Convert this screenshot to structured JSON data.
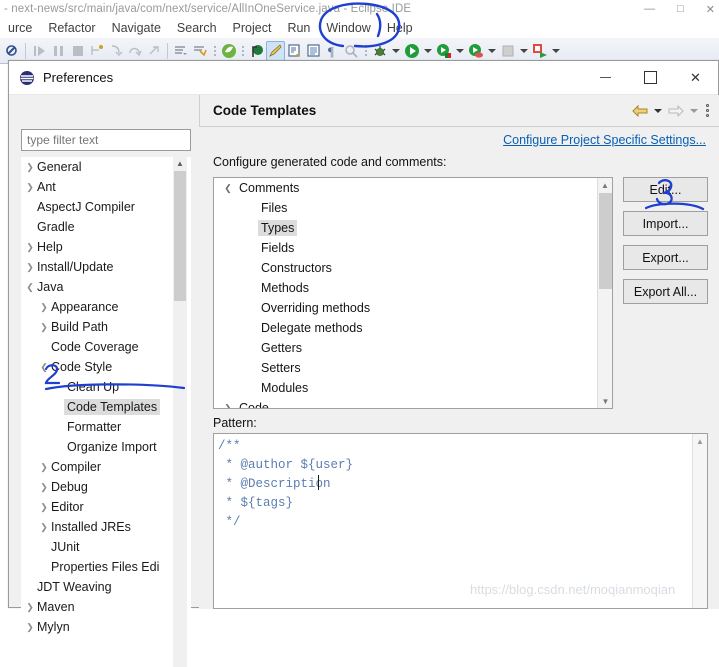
{
  "ide": {
    "title": "- next-news/src/main/java/com/next/service/AllInOneService.java - Eclipse IDE",
    "window_buttons": {
      "minimize": "—",
      "maximize": "□",
      "close": "✕"
    },
    "menu_items": [
      {
        "label": "urce",
        "name": "menu-source"
      },
      {
        "label": "Refactor",
        "name": "menu-refactor"
      },
      {
        "label": "Navigate",
        "name": "menu-navigate"
      },
      {
        "label": "Search",
        "name": "menu-search"
      },
      {
        "label": "Project",
        "name": "menu-project"
      },
      {
        "label": "Run",
        "name": "menu-run"
      },
      {
        "label": "Window",
        "name": "menu-window"
      },
      {
        "label": "Help",
        "name": "menu-help"
      }
    ],
    "toolbar_icons": [
      "skip-all-breakpoints-icon",
      "resume-icon",
      "suspend-icon",
      "terminate-icon",
      "step-into-selection-icon",
      "step-into-icon",
      "step-over-icon",
      "step-return-icon",
      "open-task-icon",
      "synchronize-icon",
      "spring-boot-icon",
      "open-type-icon",
      "java-editor-icon",
      "new-java-class-icon",
      "open-console-icon",
      "pilcrow-icon",
      "search-package-icon",
      "debug-icon",
      "run-icon",
      "run-coverage-icon",
      "profile-icon",
      "stop-icon",
      "external-tools-icon"
    ]
  },
  "prefs": {
    "title": "Preferences",
    "icon": "eclipse-sphere-icon",
    "window_buttons": {
      "minimize": "minimize-icon",
      "maximize": "maximize-icon",
      "close": "✕"
    },
    "filter": {
      "placeholder": "type filter text",
      "value": ""
    },
    "tree": [
      {
        "label": "General",
        "indent": 0,
        "expander": "collapsed",
        "selected": false
      },
      {
        "label": "Ant",
        "indent": 0,
        "expander": "collapsed",
        "selected": false
      },
      {
        "label": "AspectJ Compiler",
        "indent": 0,
        "expander": "none",
        "selected": false
      },
      {
        "label": "Gradle",
        "indent": 0,
        "expander": "none",
        "selected": false
      },
      {
        "label": "Help",
        "indent": 0,
        "expander": "collapsed",
        "selected": false
      },
      {
        "label": "Install/Update",
        "indent": 0,
        "expander": "collapsed",
        "selected": false
      },
      {
        "label": "Java",
        "indent": 0,
        "expander": "expanded",
        "selected": false
      },
      {
        "label": "Appearance",
        "indent": 1,
        "expander": "collapsed",
        "selected": false
      },
      {
        "label": "Build Path",
        "indent": 1,
        "expander": "collapsed",
        "selected": false
      },
      {
        "label": "Code Coverage",
        "indent": 1,
        "expander": "none",
        "selected": false
      },
      {
        "label": "Code Style",
        "indent": 1,
        "expander": "expanded",
        "selected": false
      },
      {
        "label": "Clean Up",
        "indent": 2,
        "expander": "none",
        "selected": false
      },
      {
        "label": "Code Templates",
        "indent": 2,
        "expander": "none",
        "selected": true
      },
      {
        "label": "Formatter",
        "indent": 2,
        "expander": "none",
        "selected": false
      },
      {
        "label": "Organize Import",
        "indent": 2,
        "expander": "none",
        "selected": false
      },
      {
        "label": "Compiler",
        "indent": 1,
        "expander": "collapsed",
        "selected": false
      },
      {
        "label": "Debug",
        "indent": 1,
        "expander": "collapsed",
        "selected": false
      },
      {
        "label": "Editor",
        "indent": 1,
        "expander": "collapsed",
        "selected": false
      },
      {
        "label": "Installed JREs",
        "indent": 1,
        "expander": "collapsed",
        "selected": false
      },
      {
        "label": "JUnit",
        "indent": 1,
        "expander": "none",
        "selected": false
      },
      {
        "label": "Properties Files Edi",
        "indent": 1,
        "expander": "none",
        "selected": false
      },
      {
        "label": "JDT Weaving",
        "indent": 0,
        "expander": "none",
        "selected": false
      },
      {
        "label": "Maven",
        "indent": 0,
        "expander": "collapsed",
        "selected": false
      },
      {
        "label": "Mylyn",
        "indent": 0,
        "expander": "collapsed",
        "selected": false
      }
    ],
    "page": {
      "title": "Code Templates",
      "nav": {
        "back": "back-arrow-icon",
        "forward": "forward-arrow-icon",
        "menu": "page-menu-icon"
      },
      "configure_link": "Configure Project Specific Settings...",
      "section_label": "Configure generated code and comments:",
      "templates_tree": [
        {
          "label": "Comments",
          "indent": 0,
          "expander": "expanded",
          "selected": false
        },
        {
          "label": "Files",
          "indent": 1,
          "expander": "none",
          "selected": false
        },
        {
          "label": "Types",
          "indent": 1,
          "expander": "none",
          "selected": true
        },
        {
          "label": "Fields",
          "indent": 1,
          "expander": "none",
          "selected": false
        },
        {
          "label": "Constructors",
          "indent": 1,
          "expander": "none",
          "selected": false
        },
        {
          "label": "Methods",
          "indent": 1,
          "expander": "none",
          "selected": false
        },
        {
          "label": "Overriding methods",
          "indent": 1,
          "expander": "none",
          "selected": false
        },
        {
          "label": "Delegate methods",
          "indent": 1,
          "expander": "none",
          "selected": false
        },
        {
          "label": "Getters",
          "indent": 1,
          "expander": "none",
          "selected": false
        },
        {
          "label": "Setters",
          "indent": 1,
          "expander": "none",
          "selected": false
        },
        {
          "label": "Modules",
          "indent": 1,
          "expander": "none",
          "selected": false
        },
        {
          "label": "Code",
          "indent": 0,
          "expander": "collapsed",
          "selected": false
        }
      ],
      "buttons": [
        {
          "label": "Edit...",
          "name": "edit-button"
        },
        {
          "label": "Import...",
          "name": "import-button"
        },
        {
          "label": "Export...",
          "name": "export-button"
        },
        {
          "label": "Export All...",
          "name": "export-all-button"
        }
      ],
      "pattern_label": "Pattern:",
      "pattern_value": "/**\n * @author ${user}\n * @Description\n * ${tags}\n */"
    }
  },
  "annotations": [
    {
      "id": 1,
      "label": "1",
      "target": "Window menu",
      "shape": "circle-with-stroke",
      "color": "#1f3fd0"
    },
    {
      "id": 2,
      "label": "2",
      "target": "Code Templates tree item",
      "shape": "digit-with-underline",
      "color": "#1f3fd0"
    },
    {
      "id": 3,
      "label": "3",
      "target": "Edit... button",
      "shape": "digit-with-underline",
      "color": "#1f3fd0"
    }
  ],
  "watermark": "https://blog.csdn.net/moqianmoqian",
  "colors": {
    "accent_link": "#0a5fb4",
    "dialog_bg": "#f0f0f0",
    "selection_bg": "#dcdcdc",
    "pattern_text": "#5b7db1",
    "annotation": "#1f3fd0",
    "toolbar_gradient_top": "#f3f5f9",
    "toolbar_gradient_bottom": "#e6eaf2"
  }
}
